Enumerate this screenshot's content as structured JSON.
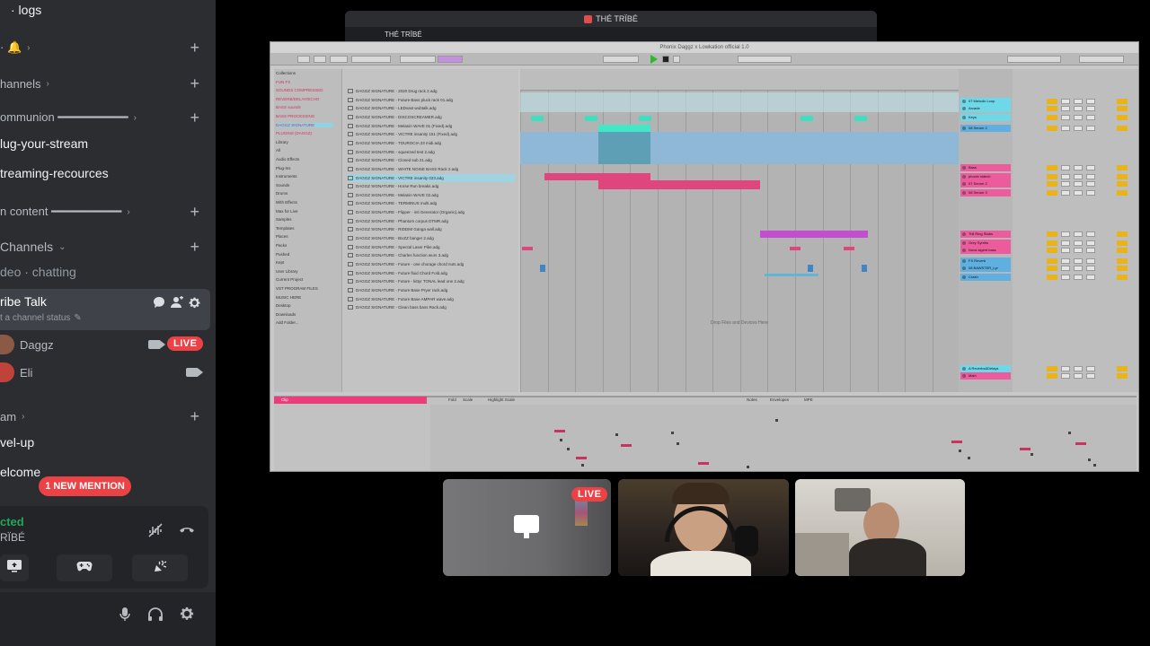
{
  "sidebar": {
    "channels": [
      {
        "label": "· logs",
        "kind": "channel"
      },
      {
        "label": "· 🔔",
        "kind": "category"
      },
      {
        "label": "hannels",
        "kind": "category"
      },
      {
        "label": "ommunion ━━━━━━━━━━",
        "kind": "category"
      },
      {
        "label": "lug-your-stream",
        "kind": "channel"
      },
      {
        "label": "treaming-recources",
        "kind": "channel"
      },
      {
        "label": "n content ━━━━━━━━━━",
        "kind": "category"
      },
      {
        "label": "Channels",
        "kind": "category"
      },
      {
        "label": "deo · chatting",
        "kind": "channel"
      }
    ],
    "voice_channel": {
      "name": "ribe Talk",
      "status_placeholder": "t a channel status"
    },
    "members": [
      {
        "name": "Daggz",
        "live_label": "LIVE"
      },
      {
        "name": "Eli"
      }
    ],
    "lower_channels": [
      {
        "label": "am",
        "kind": "category"
      },
      {
        "label": "vel-up",
        "kind": "channel"
      },
      {
        "label": "elcome",
        "kind": "channel"
      }
    ],
    "mention_pill": "1 NEW MENTION",
    "voice_panel": {
      "status": "cted",
      "server": "RÏBÉ"
    }
  },
  "stream": {
    "back_window_title": "THÉ TRÏBÉ",
    "back_window_tab": "THÉ TRÏBÉ",
    "ableton_title": "Phonix Daggz x Lowkation official 1.0",
    "drop_text": "Drop Files and Devices Here",
    "screen_tile_live": "LIVE"
  },
  "ableton": {
    "places": [
      "Collections",
      "FUN FX",
      "SOUNDS COMPRESSED",
      "REVERB/DELAY/ECHO",
      "BASS sounds",
      "BASS PROCESSING",
      "DAGGZ SIGNATURE",
      "PLUGINS (DAGGZ)",
      "Library",
      "All",
      "Audio Effects",
      "Plug-Ins",
      "Instruments",
      "Sounds",
      "Drums",
      "With Effects",
      "Max for Live",
      "Samples",
      "Templates",
      "Places",
      "Packs",
      "Pushed",
      "Kept",
      "User Library",
      "Current Project",
      "VST PROGRAM FILES",
      "MUSIC HERE",
      "Desktop",
      "Downloads",
      "Add Folder..."
    ],
    "files": [
      "DAGGZ SIGNATURE - 2020 Drug rack 2.adg",
      "DAGGZ SIGNATURE - Future Bass pluck rack 01.adg",
      "DAGGZ SIGNATURE - LEDvast wubtalk.adg",
      "DAGGZ SIGNATURE - DISCOSCREAMER.adg",
      "DAGGZ SIGNATURE - Melanin WAVE 01 (Fixed).adg",
      "DAGGZ SIGNATURE - VICTRE insanity 151 (Fixed).adg",
      "DAGGZ SIGNATURE - TOUROCIA 23 midi.adg",
      "DAGGZ SIGNATURE - squeezed test 2.adg",
      "DAGGZ SIGNATURE - Closed sub 21.adg",
      "DAGGZ SIGNATURE - WHITE NOISE BASS Rack 2.adg",
      "DAGGZ SIGNATURE - VICTRE insanity 023.adg",
      "DAGGZ SIGNATURE - Horse Run breaks.adg",
      "DAGGZ SIGNATURE - Melanin WAVE 02.adg",
      "DAGGZ SIGNATURE - TERMINUS multi.adg",
      "DAGGZ SIGNATURE - Flipper - inti Generator (Organic).adg",
      "DAGGZ SIGNATURE - Phantom corpus DTMR.adg",
      "DAGGZ SIGNATURE - RIDDIM Ganga wall.adg",
      "DAGGZ SIGNATURE - BUZZ banger 2.adg",
      "DAGGZ SIGNATURE - Spectal Laser Pike.adg",
      "DAGGZ SIGNATURE - Charles function wurs 3.adg",
      "DAGGZ SIGNATURE - Future - one chorage chord nuts.adg",
      "DAGGZ SIGNATURE - Future fluid Chord Fold.adg",
      "DAGGZ SIGNATURE - Future - kittyr TONAL lead one 2.adg",
      "DAGGZ SIGNATURE - Future Base Pryer rack.adg",
      "DAGGZ SIGNATURE - Future Base AMPAR wave.adg",
      "DAGGZ SIGNATURE - Clean bass bass Rack.adg"
    ],
    "tracks": [
      {
        "name": "07 Melodic Loop",
        "color": "#6ed7e8"
      },
      {
        "name": "Arcade",
        "color": "#6ed7e8"
      },
      {
        "name": "Keys",
        "color": "#6ed7e8"
      },
      {
        "name": "08 Serum 2",
        "color": "#5fb0e0"
      },
      {
        "name": "Bass",
        "color": "#ec5c9c"
      },
      {
        "name": "phonix sidech",
        "color": "#ec5c9c"
      },
      {
        "name": "07 Serum 2",
        "color": "#ec5c9c"
      },
      {
        "name": "08 Serum 3",
        "color": "#ec5c9c"
      },
      {
        "name": "Trill Ring Stabs",
        "color": "#ec5c9c"
      },
      {
        "name": "Grey Synths",
        "color": "#ec5c9c"
      },
      {
        "name": "Nova sigent bass",
        "color": "#ec5c9c"
      },
      {
        "name": "FX Reverb",
        "color": "#5fb0e0"
      },
      {
        "name": "08 BAWSTER_Lyr",
        "color": "#5fb0e0"
      },
      {
        "name": "Crash",
        "color": "#5fb0e0"
      },
      {
        "name": "A Reverbs&Delays",
        "color": "#6ed7e8"
      },
      {
        "name": "Main",
        "color": "#ec5c9c"
      }
    ],
    "tabs": [
      "Clip",
      "Fold",
      "Scale",
      "Highlight Scale",
      "Notes",
      "Envelopes",
      "MPE"
    ]
  }
}
